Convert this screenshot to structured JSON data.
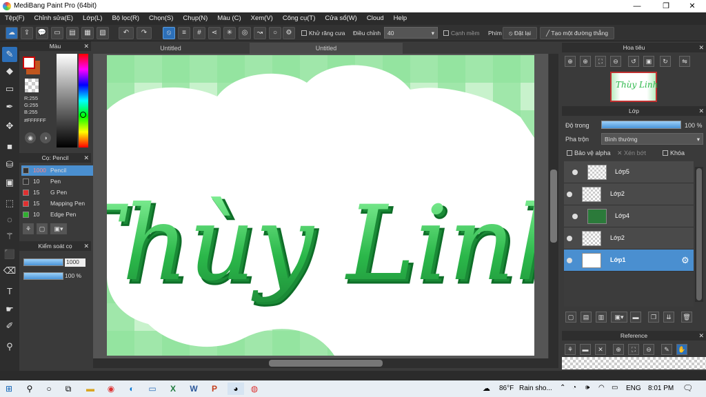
{
  "app": {
    "title": "MediBang Paint Pro (64bit)"
  },
  "window_controls": {
    "minimize": "—",
    "maximize": "❐",
    "close": "✕"
  },
  "menu": [
    "Tệp(F)",
    "Chỉnh sửa(E)",
    "Lớp(L)",
    "Bộ lọc(R)",
    "Chọn(S)",
    "Chụp(N)",
    "Màu (C)",
    "Xem(V)",
    "Công cụ(T)",
    "Cửa sổ(W)",
    "Cloud",
    "Help"
  ],
  "toolbar": {
    "antialias_label": "Khử răng cưa",
    "adjust_label": "Điều chỉnh",
    "adjust_value": "40",
    "soft_edge_label": "Cạnh mềm",
    "key_label": "Phím",
    "reset_label": "Đặt lại",
    "straight_line_label": "Tạo một đường thẳng"
  },
  "tabs": [
    "Untitled",
    "Untitled"
  ],
  "color_panel": {
    "title": "Màu",
    "r": "R:255",
    "g": "G:255",
    "b": "B:255",
    "hex": "#FFFFFF",
    "fg": "#ffffff",
    "bg": "#c0561e"
  },
  "brush_panel": {
    "title": "Cọ: Pencil",
    "brushes": [
      {
        "size": "1000",
        "name": "Pencil",
        "color": "#333333",
        "selected": true
      },
      {
        "size": "10",
        "name": "Pen",
        "color": "#333333"
      },
      {
        "size": "15",
        "name": "G Pen",
        "color": "#e03030"
      },
      {
        "size": "15",
        "name": "Mapping Pen",
        "color": "#e03030"
      },
      {
        "size": "10",
        "name": "Edge Pen",
        "color": "#30b030"
      }
    ]
  },
  "brush_control": {
    "title": "Kiểm soát cọ",
    "size_value": "1000",
    "opacity_value": "100 %"
  },
  "canvas": {
    "text": "Thùy Linh"
  },
  "navigator": {
    "title": "Hoa tiêu"
  },
  "layer_panel": {
    "title": "Lớp",
    "opacity_label": "Độ trong",
    "opacity_value": "100 %",
    "blend_label": "Pha trộn",
    "blend_value": "Bình thường",
    "protect_alpha": "Bảo vệ alpha",
    "clipping": "Xén bớt",
    "lock": "Khóa",
    "layers": [
      {
        "name": "Lớp5"
      },
      {
        "name": "Lớp2"
      },
      {
        "name": "Lớp4"
      },
      {
        "name": "Lớp2"
      },
      {
        "name": "Lớp1",
        "selected": true
      }
    ]
  },
  "reference": {
    "title": "Reference"
  },
  "taskbar": {
    "weather_temp": "86°F",
    "weather_text": "Rain sho...",
    "lang": "ENG",
    "time": "8:01 PM"
  }
}
